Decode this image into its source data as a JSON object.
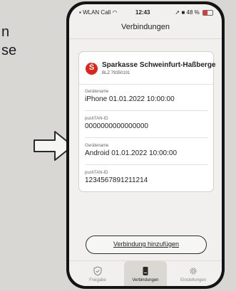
{
  "background_text": [
    "n",
    "se"
  ],
  "status_bar": {
    "carrier": "WLAN Call",
    "time": "12:43",
    "battery": "48 %",
    "battery_level": 0.48
  },
  "nav": {
    "title": "Verbindungen"
  },
  "card": {
    "bank_name": "Sparkasse Schweinfurt-Haßberge",
    "blz": "BLZ 79350101",
    "fields": [
      {
        "label": "Gerätename",
        "value": "iPhone 01.01.2022 10:00:00"
      },
      {
        "label": "pushTAN-ID",
        "value": "0000000000000000"
      },
      {
        "label": "Gerätename",
        "value": "Android 01.01.2022 10:00:00"
      },
      {
        "label": "pushTAN-ID",
        "value": "1234567891211214"
      }
    ]
  },
  "add_button": {
    "label": "Verbindung hinzufügen"
  },
  "tabs": [
    {
      "label": "Freigabe",
      "icon": "shield-check-icon"
    },
    {
      "label": "Verbindungen",
      "icon": "phone-icon",
      "active": true
    },
    {
      "label": "Einstellungen",
      "icon": "gear-icon"
    }
  ],
  "colors": {
    "brand": "#e02418",
    "background": "#d8d7d3",
    "screen": "#f1f0ee"
  }
}
